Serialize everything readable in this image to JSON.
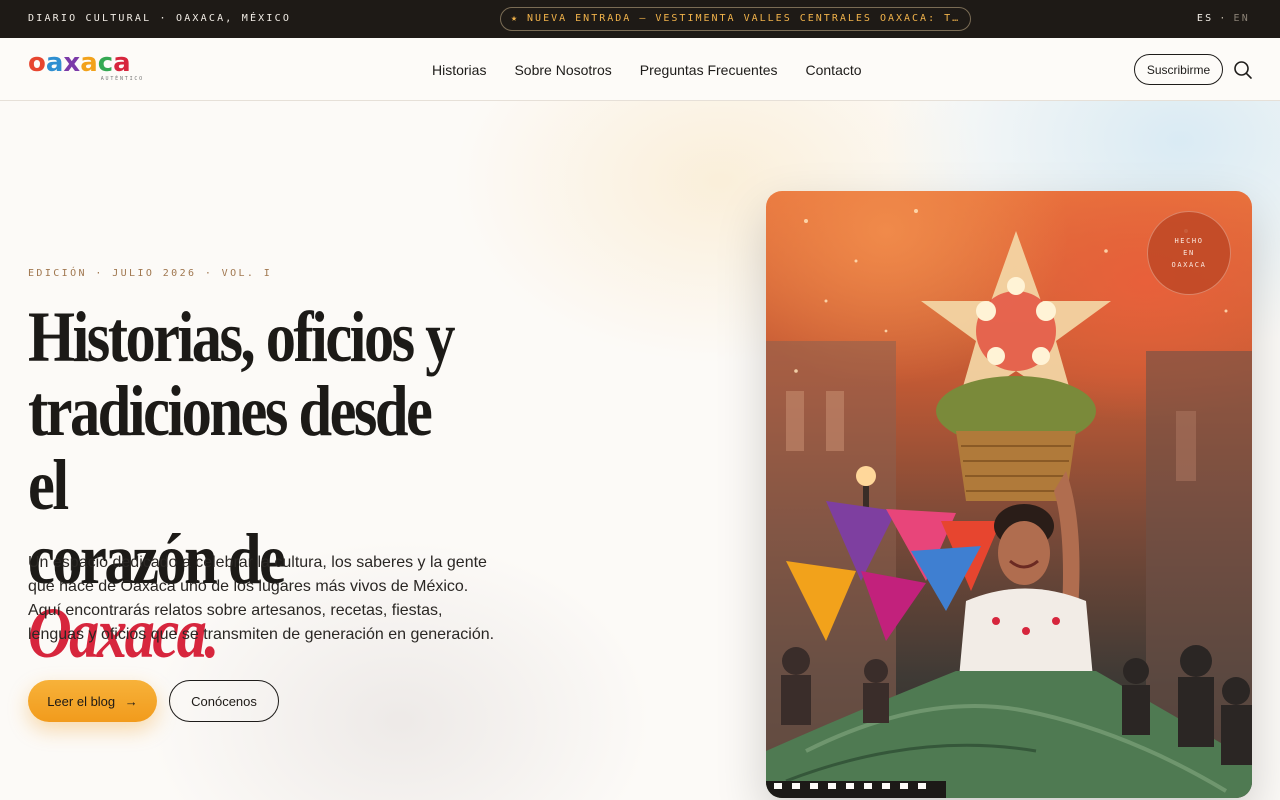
{
  "topbar": {
    "left_text": "DIARIO CULTURAL · OAXACA, MÉXICO",
    "announcement": "★ NUEVA ENTRADA — VESTIMENTA VALLES CENTRALES OAXACA: TEXT…",
    "lang_active": "ES",
    "lang_separator": "·",
    "lang_inactive": "EN"
  },
  "nav": {
    "logo_letters": [
      "o",
      "a",
      "x",
      "a",
      "c",
      "a"
    ],
    "logo_colors": [
      "#e7452f",
      "#2f8fd1",
      "#7b3aa8",
      "#f2a21b",
      "#35a853",
      "#d7263d"
    ],
    "logo_sub": "AUTÉNTICO",
    "items": [
      {
        "label": "Historias"
      },
      {
        "label": "Sobre Nosotros"
      },
      {
        "label": "Preguntas Frecuentes"
      },
      {
        "label": "Contacto"
      }
    ],
    "subscribe_label": "Suscribirme",
    "search_icon": "search-icon"
  },
  "hero": {
    "kicker": "EDICIÓN · JULIO 2026 · VOL. I",
    "headline_line1": "Historias, oficios y",
    "headline_line2": "tradiciones desde el",
    "headline_line3_plain": "corazón de",
    "headline_accent": "Oaxaca.",
    "lead": "Un espacio dedicado a celebrar la cultura, los saberes y la gente que hace de Oaxaca uno de los lugares más vivos de México. Aquí encontrarás relatos sobre artesanos, recetas, fiestas, lenguas y oficios que se transmiten de generación en generación.",
    "primary_button": "Leer el blog",
    "primary_arrow": "→",
    "secondary_button": "Conócenos",
    "badge_line1": "HECHO",
    "badge_line2": "EN",
    "badge_line3": "OAXACA"
  },
  "colors": {
    "accent": "#d7263d",
    "primary_button": "#f5a623",
    "topbar_bg": "#1e1a16"
  }
}
